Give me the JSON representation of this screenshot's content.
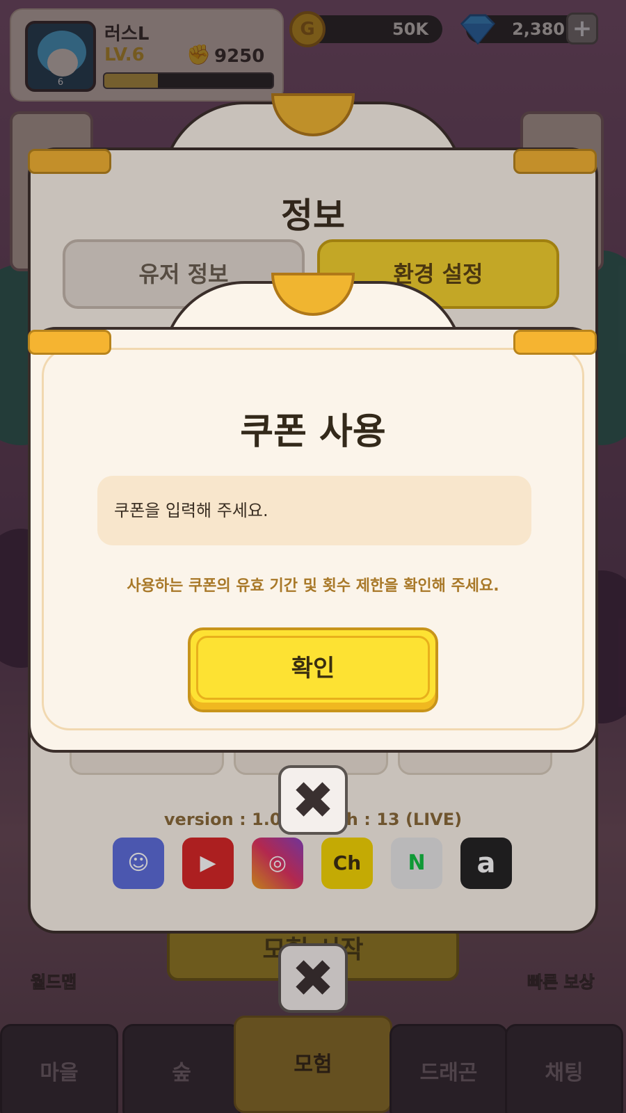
{
  "profile": {
    "name": "러스L",
    "level": "LV.6",
    "avatar_level": "6",
    "power": "9250",
    "xp_progress": 0.32
  },
  "currency": {
    "gold": "50K",
    "gold_icon": "G",
    "gems": "2,380",
    "add_label": "+"
  },
  "side": {
    "worldmap": "월드맵",
    "fast_reward": "빠른 보상"
  },
  "background_button": "모험 시작",
  "nav": [
    {
      "label": "마을",
      "icon": "house-icon"
    },
    {
      "label": "숲",
      "icon": "tree-icon"
    },
    {
      "label": "모험",
      "icon": "compass-icon",
      "active": true
    },
    {
      "label": "드래곤",
      "icon": "dragon-icon"
    },
    {
      "label": "채팅",
      "icon": "chat-icon"
    }
  ],
  "info_dialog": {
    "title": "정보",
    "tabs": [
      "유저 정보",
      "환경 설정"
    ],
    "active_tab": "환경 설정",
    "version": "version : 1.0.0 patch : 13 (LIVE)",
    "social": [
      "discord-icon",
      "youtube-icon",
      "instagram-icon",
      "kakao-channel-icon",
      "naver-icon",
      "amazon-icon"
    ],
    "close": "✖"
  },
  "coupon_dialog": {
    "title": "쿠폰 사용",
    "input_placeholder": "쿠폰을 입력해 주세요.",
    "notice": "사용하는 쿠폰의 유효 기간 및 횟수 제한을 확인해 주세요.",
    "confirm_label": "확인",
    "close": "✖"
  },
  "colors": {
    "accent_yellow": "#fde233",
    "panel_bg": "#fbf4ea",
    "gold_frame": "#f0b530",
    "notice": "#a87828"
  }
}
